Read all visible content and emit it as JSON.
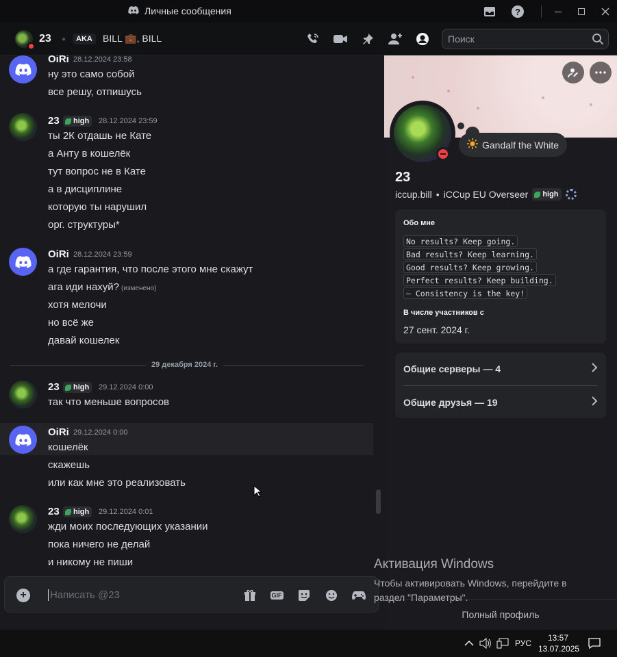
{
  "window": {
    "title": "Личные сообщения"
  },
  "header": {
    "name": "23",
    "aka": "AKA",
    "nick": "BILL 💼, BILL",
    "search_placeholder": "Поиск"
  },
  "messages": [
    {
      "user": "OiRi",
      "time": "28.12.2024 23:58",
      "avatar": "discord",
      "tag": "",
      "lines": [
        "ну это само собой",
        "все решу, отпишусь"
      ]
    },
    {
      "user": "23",
      "time": "28.12.2024 23:59",
      "avatar": "green",
      "tag": "high",
      "lines": [
        "ты 2К отдашь не Кате",
        "а Анту в кошелёк",
        "тут вопрос не в Кате",
        "а в дисциплине",
        "которую ты нарушил",
        "орг. структуры*"
      ]
    },
    {
      "user": "OiRi",
      "time": "28.12.2024 23:59",
      "avatar": "discord",
      "tag": "",
      "lines": [
        "а где гарантия, что после этого мне скажут",
        "ага иди нахуй?",
        "хотя мелочи",
        "но всё же",
        "давай кошелек"
      ],
      "edited_label": "(изменено)"
    },
    {
      "user": "23",
      "time": "29.12.2024 0:00",
      "avatar": "green",
      "tag": "high",
      "lines": [
        "так что меньше вопросов"
      ]
    },
    {
      "user": "OiRi",
      "time": "29.12.2024 0:00",
      "avatar": "discord",
      "tag": "",
      "lines": [
        "кошелёк",
        "скажешь",
        "или как мне это реализовать"
      ]
    },
    {
      "user": "23",
      "time": "29.12.2024 0:01",
      "avatar": "green",
      "tag": "high",
      "lines": [
        "жди моих последующих указании",
        "пока ничего не делай",
        "и никому не пиши"
      ]
    }
  ],
  "date_divider": "29 декабря 2024 г.",
  "composer": {
    "placeholder": "Написать @23",
    "gif_label": "GIF"
  },
  "profile": {
    "status": "Gandalf the White",
    "name": "23",
    "username": "iccup.bill",
    "bullet": "•",
    "custom": "iCCup EU Overseer",
    "tag": "high",
    "about_title": "Обо мне",
    "about_lines": [
      "No results? Keep going.",
      "Bad results? Keep learning.",
      "Good results? Keep growing.",
      "Perfect results? Keep building.",
      "— Consistency is the key!"
    ],
    "member_since_title": "В числе участников с",
    "member_since": "27 сент. 2024 г.",
    "mutual_servers": "Общие серверы — 4",
    "mutual_friends": "Общие друзья — 19",
    "full_profile": "Полный профиль"
  },
  "watermark": {
    "title": "Активация Windows",
    "line1": "Чтобы активировать Windows, перейдите в",
    "line2": "раздел \"Параметры\"."
  },
  "taskbar": {
    "lang": "РУС",
    "time": "13:57",
    "date": "13.07.2025"
  },
  "colors": {
    "blurple": "#5865f2",
    "dnd": "#f23f43",
    "leaf": "#3ba55c"
  }
}
